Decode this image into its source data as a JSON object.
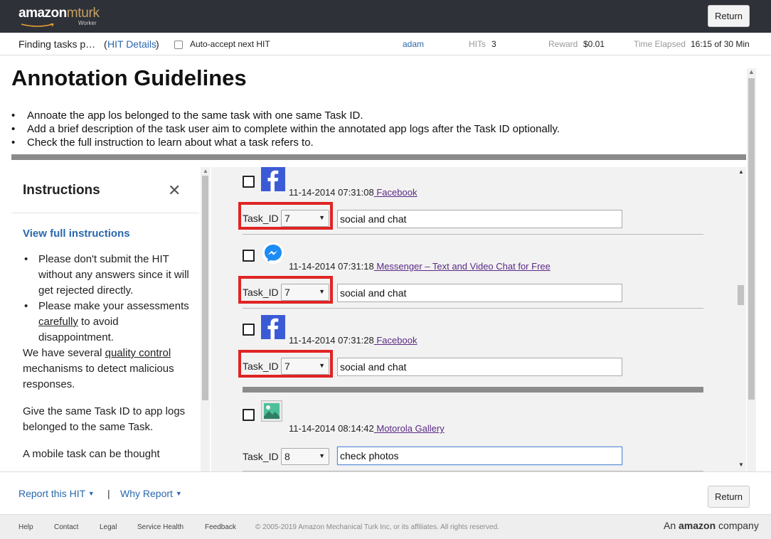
{
  "header": {
    "logo": {
      "word_amazon": "amazon",
      "word_mturk": "mturk",
      "subtitle": "Worker"
    },
    "return_label": "Return"
  },
  "status": {
    "task_title": "Finding tasks p…",
    "hit_details_open": "(",
    "hit_details_link": "HIT Details",
    "hit_details_close": ")",
    "auto_accept_label": "Auto-accept next HIT",
    "user": "adam",
    "hits_label": "HITs",
    "hits_value": "3",
    "reward_label": "Reward",
    "reward_value": "$0.01",
    "time_label": "Time Elapsed",
    "time_value": "16:15 of 30 Min"
  },
  "guidelines": {
    "title": "Annotation Guidelines",
    "bullets": [
      "Annoate the app los belonged to the same task with one same Task ID.",
      "Add a brief description of the task user aim to complete within the annotated app logs after the Task ID optionally.",
      "Check the full instruction to learn about what a task refers to."
    ]
  },
  "instructions": {
    "heading": "Instructions",
    "close_glyph": "✕",
    "view_full": "View full instructions",
    "b1": "Please don't submit the HIT without any answers since it will get rejected directly.",
    "b2_pre": "Please make your assessments ",
    "b2_u": "carefully",
    "b2_post": " to avoid disappointment.",
    "p1_pre": "We have several ",
    "p1_u": "quality control",
    "p1_post": " mechanisms to detect malicious responses.",
    "p2": "Give the same Task ID to app logs belonged to the same Task.",
    "p3": "A mobile task can be thought"
  },
  "tasks": [
    {
      "icon": "facebook-icon",
      "timestamp": "11-14-2014 07:31:08",
      "app": " Facebook",
      "task_id_label": "Task_ID",
      "task_id": "7",
      "description": "social and chat",
      "highlighted": true
    },
    {
      "icon": "messenger-icon",
      "timestamp": "11-14-2014 07:31:18",
      "app": " Messenger – Text and Video Chat for Free",
      "task_id_label": "Task_ID",
      "task_id": "7",
      "description": "social and chat",
      "highlighted": true
    },
    {
      "icon": "facebook-icon",
      "timestamp": "11-14-2014 07:31:28",
      "app": " Facebook",
      "task_id_label": "Task_ID",
      "task_id": "7",
      "description": "social and chat",
      "highlighted": true
    },
    {
      "icon": "gallery-icon",
      "timestamp": "11-14-2014 08:14:42",
      "app": " Motorola Gallery",
      "task_id_label": "Task_ID",
      "task_id": "8",
      "description": "check photos",
      "highlighted": false
    }
  ],
  "report": {
    "report_hit": "Report this HIT",
    "pipe": "|",
    "why_report": "Why Report",
    "return_label": "Return"
  },
  "footer": {
    "help": "Help",
    "contact": "Contact",
    "legal": "Legal",
    "service_health": "Service Health",
    "feedback": "Feedback",
    "copyright": "© 2005-2019 Amazon Mechanical Turk Inc, or its affiliates. All rights reserved.",
    "brand_pre": "An ",
    "brand_bold": "amazon",
    "brand_post": " company"
  },
  "colors": {
    "topbar": "#2e3138",
    "link": "#2a68ad",
    "highlight_border": "#e02424",
    "facebook": "#3b5bd6",
    "messenger": "#1d8cf5"
  }
}
